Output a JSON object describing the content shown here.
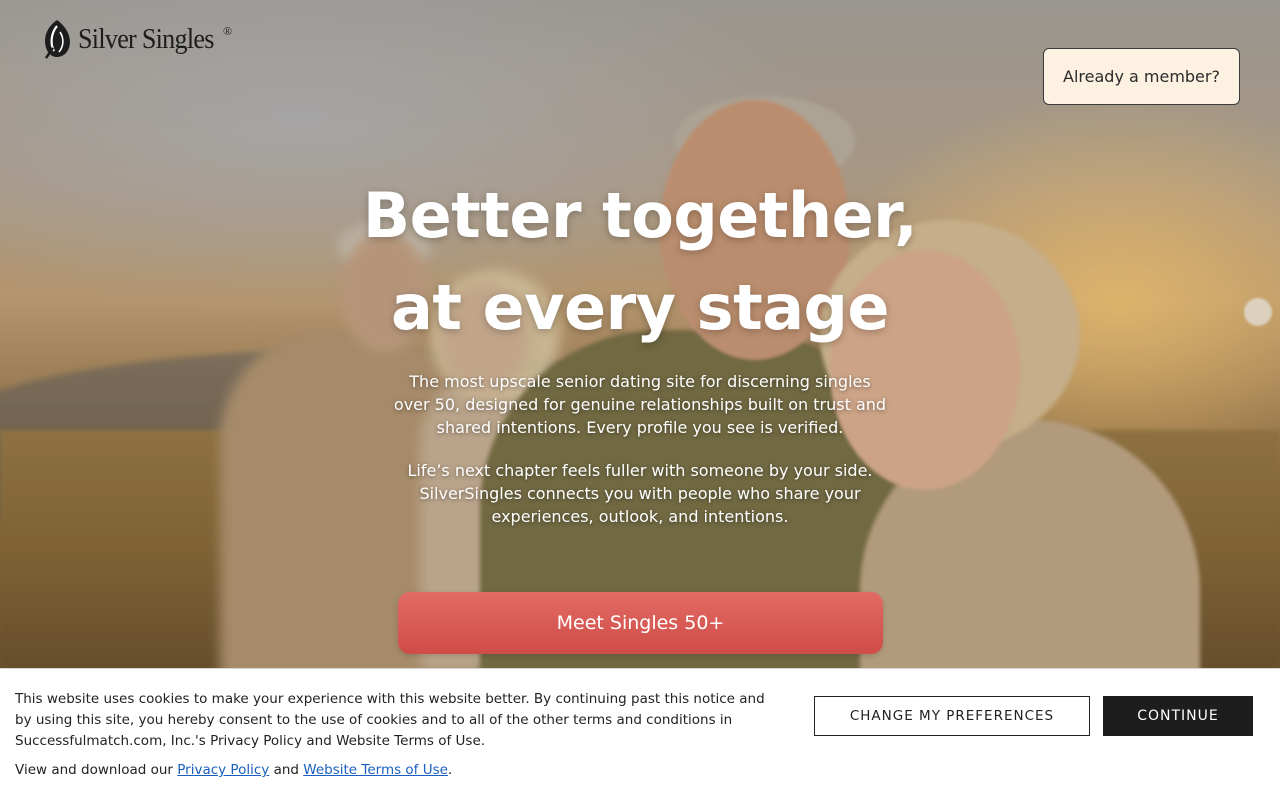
{
  "header": {
    "logo_text": "Silver Singles",
    "logo_mark": "®",
    "logo_icon": "silversingles-leaf-icon",
    "member_button": "Already a member?"
  },
  "hero": {
    "headline_line1": "Better together,",
    "headline_line2": "at every stage",
    "paragraph1": "The most upscale senior dating site for discerning singles over 50, designed for genuine relationships built on trust and shared intentions. Every profile you see is verified.",
    "paragraph2": "Life’s next chapter feels fuller with someone by your side. SilverSingles connects you with people who share your experiences, outlook, and intentions.",
    "cta_label": "Meet Singles 50+",
    "cta_color": "#d9564f",
    "background_image": "older couples embracing in a sunlit meadow"
  },
  "cookie_banner": {
    "text": "This website uses cookies to make your experience with this website better. By continuing past this notice and by using this site, you hereby consent to the use of cookies and to all of the other terms and conditions in Successfulmatch.com, Inc.'s Privacy Policy and Website Terms of Use.",
    "links_prefix": "View and download our",
    "privacy_link": "Privacy Policy",
    "links_and": "and",
    "terms_link": "Website Terms of Use",
    "links_suffix": ".",
    "preferences_button": "CHANGE MY PREFERENCES",
    "continue_button": "CONTINUE",
    "link_color": "#1a5fbf"
  }
}
